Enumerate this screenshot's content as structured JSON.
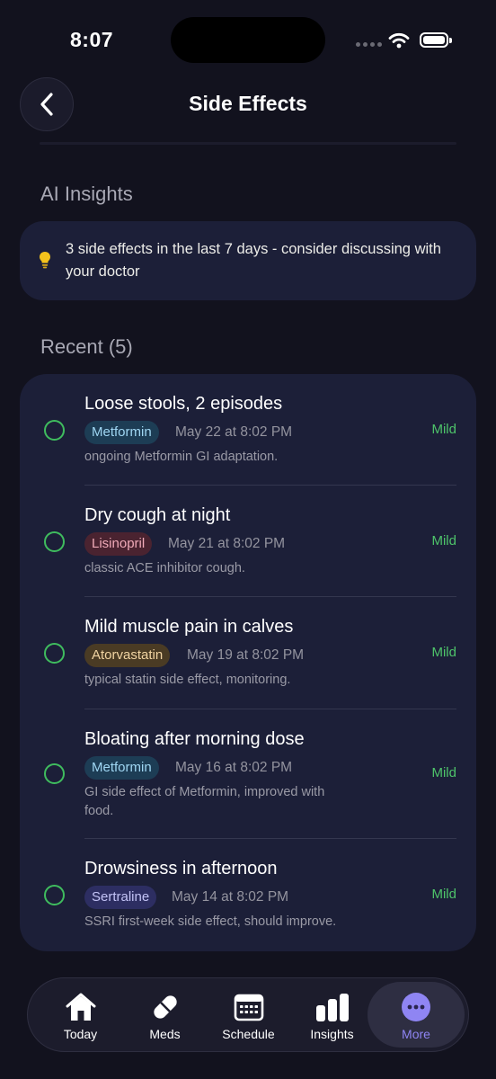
{
  "status_bar": {
    "time": "8:07"
  },
  "header": {
    "title": "Side Effects"
  },
  "ai_insights": {
    "section_title": "AI Insights",
    "icon": "lightbulb-icon",
    "message": "3 side effects in the last 7 days - consider discussing with your doctor"
  },
  "recent": {
    "section_title": "Recent (5)",
    "entries": [
      {
        "title": "Loose stools, 2 episodes",
        "medication": "Metformin",
        "date": "May 22 at 8:02 PM",
        "note": "ongoing Metformin GI adaptation.",
        "severity": "Mild"
      },
      {
        "title": "Dry cough at night",
        "medication": "Lisinopril",
        "date": "May 21 at 8:02 PM",
        "note": "classic ACE inhibitor cough.",
        "severity": "Mild"
      },
      {
        "title": "Mild muscle pain in calves",
        "medication": "Atorvastatin",
        "date": "May 19 at 8:02 PM",
        "note": "typical statin side effect, monitoring.",
        "severity": "Mild"
      },
      {
        "title": "Bloating after morning dose",
        "medication": "Metformin",
        "date": "May 16 at 8:02 PM",
        "note": "GI side effect of Metformin, improved with food.",
        "severity": "Mild"
      },
      {
        "title": "Drowsiness in afternoon",
        "medication": "Sertraline",
        "date": "May 14 at 8:02 PM",
        "note": "SSRI first-week side effect, should improve.",
        "severity": "Mild"
      }
    ]
  },
  "medication_colors": {
    "Metformin": {
      "bg": "#1d3d55",
      "fg": "#9fd6f2"
    },
    "Lisinopril": {
      "bg": "#4a2330",
      "fg": "#f0aab8"
    },
    "Atorvastatin": {
      "bg": "#4a3b24",
      "fg": "#f0d3a2"
    },
    "Sertraline": {
      "bg": "#2d2e62",
      "fg": "#c3c3f6"
    }
  },
  "colors": {
    "accent": "#8f85f3",
    "mild": "#4ec46a",
    "card": "#1c1f38",
    "background": "#12121e"
  },
  "tab_bar": {
    "tabs": [
      {
        "label": "Today",
        "icon": "house-icon"
      },
      {
        "label": "Meds",
        "icon": "pill-icon"
      },
      {
        "label": "Schedule",
        "icon": "calendar-icon"
      },
      {
        "label": "Insights",
        "icon": "bar-chart-icon"
      },
      {
        "label": "More",
        "icon": "more-dots-icon",
        "active": true
      }
    ]
  }
}
